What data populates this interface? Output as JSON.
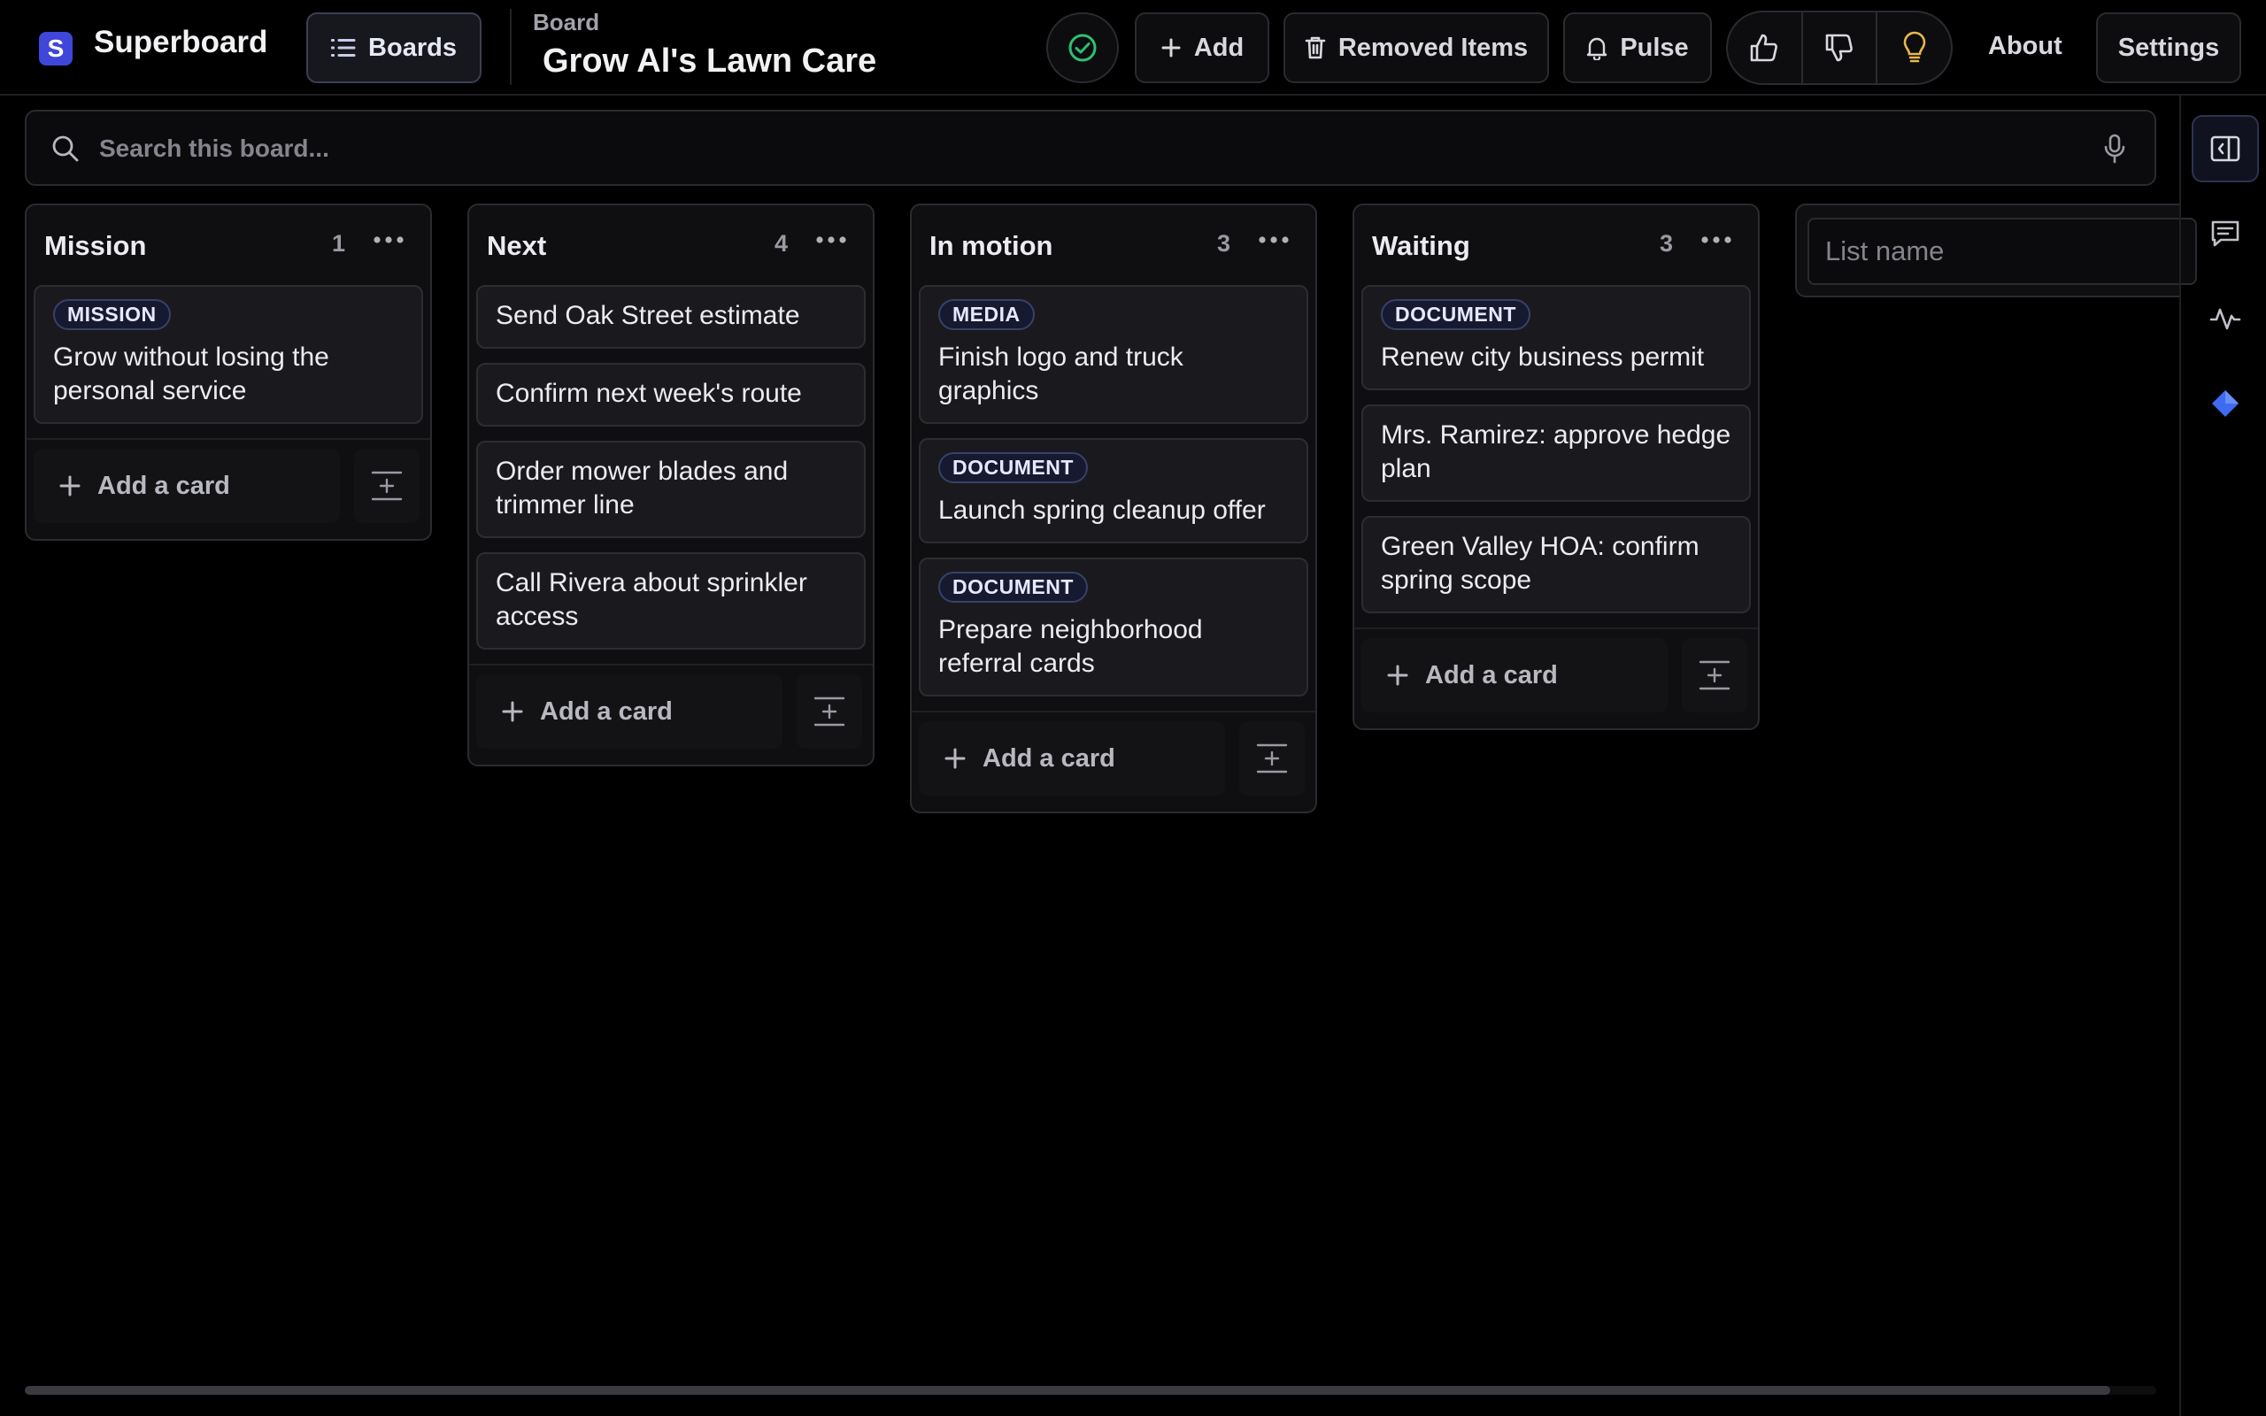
{
  "app": {
    "name": "Superboard",
    "logo_letter": "S"
  },
  "header": {
    "boards_label": "Boards",
    "board_label": "Board",
    "board_title": "Grow Al's Lawn Care",
    "add_label": "Add",
    "removed_label": "Removed Items",
    "pulse_label": "Pulse",
    "about_label": "About",
    "settings_label": "Settings"
  },
  "search": {
    "placeholder": "Search this board..."
  },
  "lists": [
    {
      "title": "Mission",
      "count": "1",
      "add_label": "Add a card",
      "cards": [
        {
          "tag": "MISSION",
          "text": "Grow without losing the personal service"
        }
      ]
    },
    {
      "title": "Next",
      "count": "4",
      "add_label": "Add a card",
      "cards": [
        {
          "tag": "",
          "text": "Send Oak Street estimate"
        },
        {
          "tag": "",
          "text": "Confirm next week's route"
        },
        {
          "tag": "",
          "text": "Order mower blades and trimmer line"
        },
        {
          "tag": "",
          "text": "Call Rivera about sprinkler access"
        }
      ]
    },
    {
      "title": "In motion",
      "count": "3",
      "add_label": "Add a card",
      "cards": [
        {
          "tag": "MEDIA",
          "text": "Finish logo and truck graphics"
        },
        {
          "tag": "DOCUMENT",
          "text": "Launch spring cleanup offer"
        },
        {
          "tag": "DOCUMENT",
          "text": "Prepare neighborhood referral cards"
        }
      ]
    },
    {
      "title": "Waiting",
      "count": "3",
      "add_label": "Add a card",
      "cards": [
        {
          "tag": "DOCUMENT",
          "text": "Renew city business permit"
        },
        {
          "tag": "",
          "text": "Mrs. Ramirez: approve hedge plan"
        },
        {
          "tag": "",
          "text": "Green Valley HOA: confirm spring scope"
        }
      ]
    }
  ],
  "new_list": {
    "placeholder": "List name"
  },
  "colors": {
    "accent": "#3f46d9",
    "check": "#2fbf71",
    "bulb": "#e8b84a",
    "gem": "#3d6bf2"
  },
  "icons": [
    "list-icon",
    "check-circle-icon",
    "plus-icon",
    "trash-icon",
    "bell-icon",
    "thumbs-up-icon",
    "thumbs-down-icon",
    "lightbulb-icon",
    "search-icon",
    "microphone-icon",
    "more-icon",
    "template-icon",
    "sidebar-toggle-icon",
    "comment-icon",
    "activity-icon",
    "gem-icon"
  ]
}
